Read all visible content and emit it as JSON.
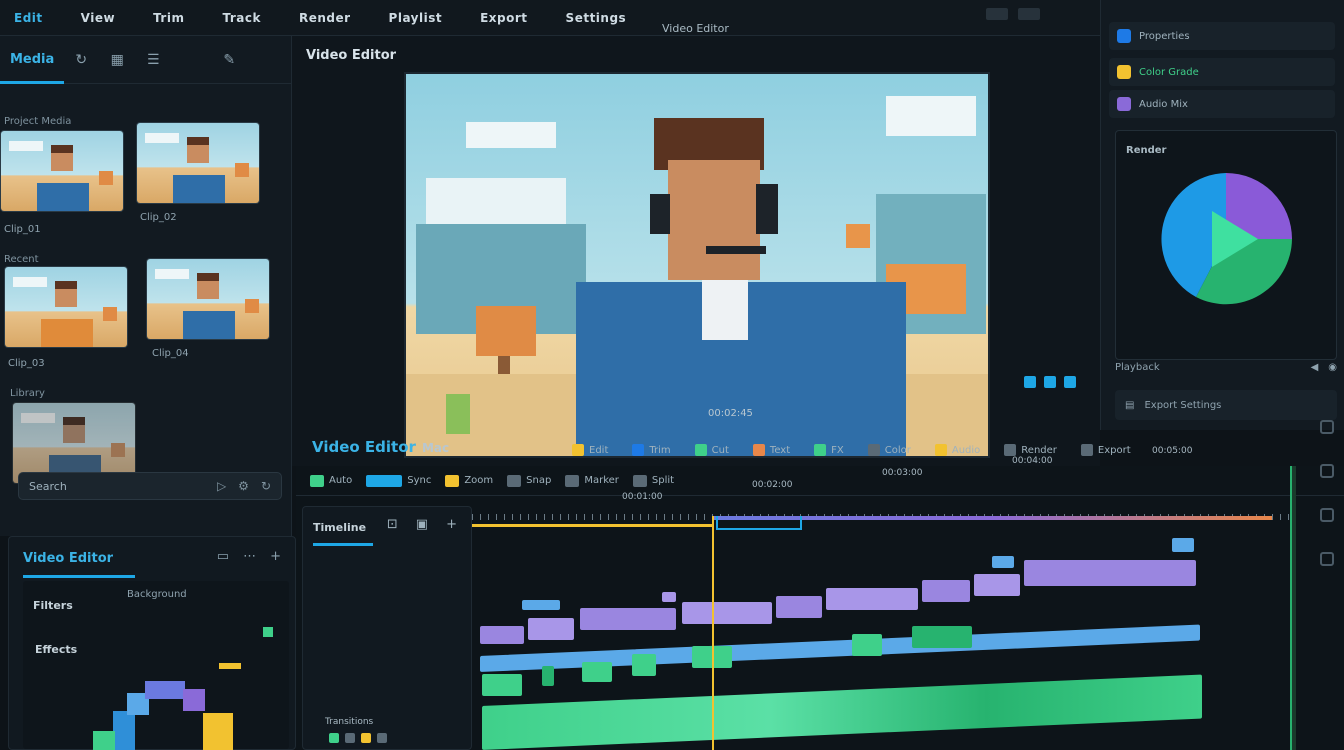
{
  "menubar": {
    "items": [
      "Edit",
      "View",
      "Trim",
      "Track",
      "Render",
      "Playlist",
      "Export",
      "Settings"
    ],
    "title": "Video Editor"
  },
  "media": {
    "tab_label": "Media",
    "section_top": "Project Media",
    "section_mid": "Recent",
    "section_bottom": "Library",
    "thumb_captions": [
      "Clip_01",
      "Clip_02",
      "Clip_03",
      "Clip_04"
    ],
    "search_label": "Search"
  },
  "effects": {
    "title": "Video Editor",
    "filter_label": "Filters",
    "effects_label": "Effects",
    "sub_label": "Background"
  },
  "preview": {
    "title": "Video Editor",
    "top_label": "Video Editor",
    "caption": "00:02:45",
    "project_name": "Video Editor",
    "project_sub": "Mac",
    "toolbar": [
      "Edit",
      "Trim",
      "Cut",
      "Text",
      "FX",
      "Color",
      "Audio",
      "Render",
      "Export"
    ]
  },
  "inspector": {
    "row1": "Properties",
    "row2": "Color Grade",
    "row3": "Audio Mix",
    "card_label": "Render",
    "footer": "Playback",
    "footer2": "Export Settings"
  },
  "timeline": {
    "toolbar": [
      "Auto",
      "Sync",
      "Zoom",
      "Snap",
      "Marker",
      "Split"
    ],
    "tracks_header": "Timeline",
    "sub_label": "Transitions",
    "ruler_labels": [
      "00:01:00",
      "00:02:00",
      "00:03:00",
      "00:04:00",
      "00:05:00"
    ]
  },
  "colors": {
    "accent": "#1ea7e6",
    "playhead": "#f2c230",
    "video_clip": "#9a86e0",
    "audio_clip": "#3fd08a",
    "blue_clip": "#5ba9e8"
  }
}
